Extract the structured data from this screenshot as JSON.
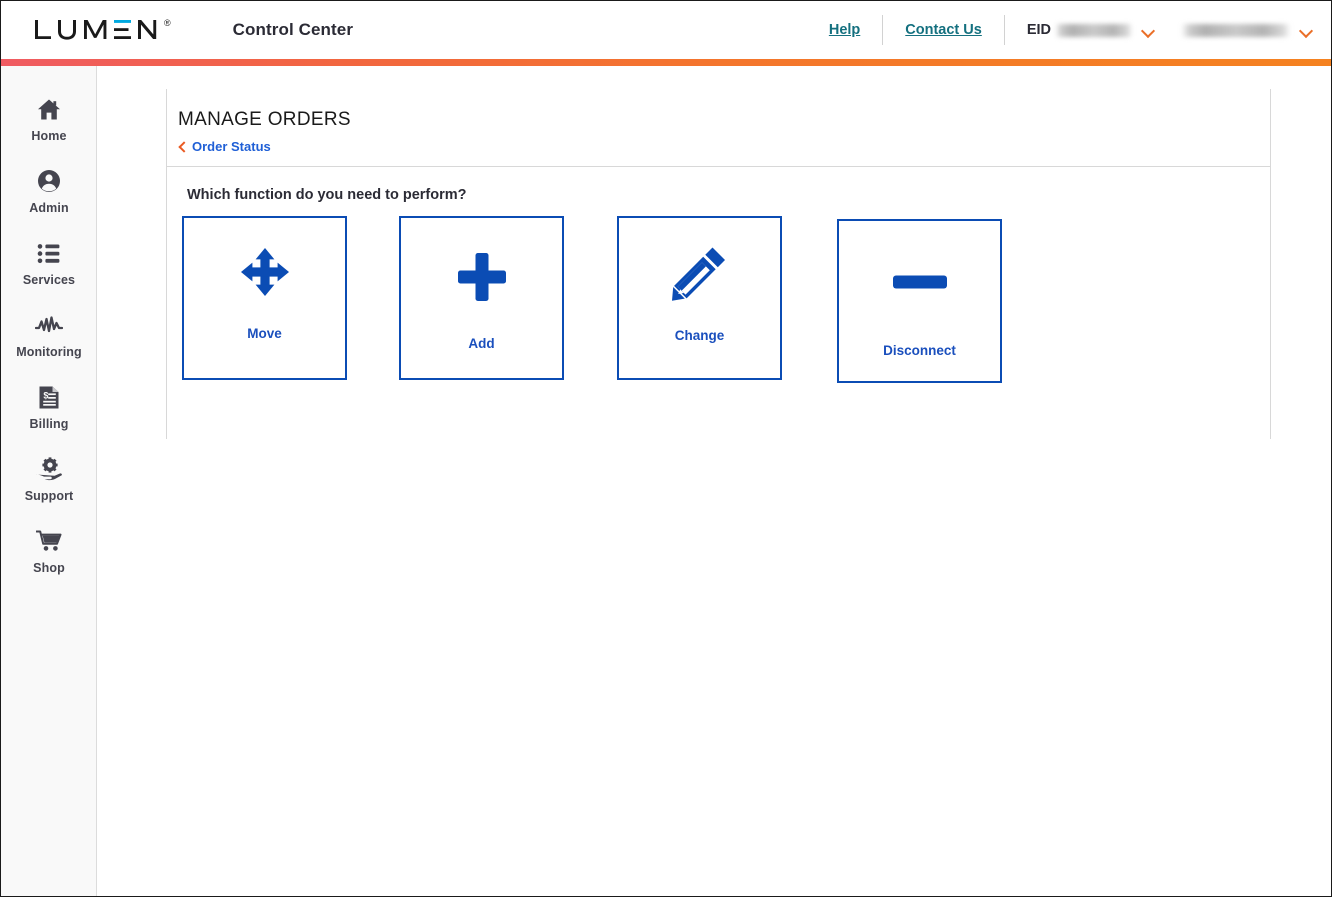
{
  "header": {
    "logo_text": "LUMEN",
    "logo_registered": "®",
    "app_title": "Control Center",
    "help_label": "Help",
    "contact_label": "Contact Us",
    "eid_label": "EID",
    "eid_value_redacted": "",
    "account_value_redacted": "",
    "link_color": "#14707f",
    "chevron_color": "#ea6f28"
  },
  "accent_bar": {
    "gradient_from": "#f05b62",
    "gradient_to": "#f58220"
  },
  "sidebar": {
    "items": [
      {
        "label": "Home",
        "icon": "home-icon"
      },
      {
        "label": "Admin",
        "icon": "user-circle-icon"
      },
      {
        "label": "Services",
        "icon": "list-icon"
      },
      {
        "label": "Monitoring",
        "icon": "waveform-icon"
      },
      {
        "label": "Billing",
        "icon": "invoice-icon"
      },
      {
        "label": "Support",
        "icon": "hand-gear-icon"
      },
      {
        "label": "Shop",
        "icon": "shopping-cart-icon"
      }
    ]
  },
  "main": {
    "page_title": "MANAGE ORDERS",
    "breadcrumb_label": "Order Status",
    "breadcrumb_color": "#1f5fd6",
    "prompt": "Which function do you need to perform?",
    "card_border_color": "#0b4cb4",
    "card_label_color": "#1a4fbd",
    "cards": [
      {
        "label": "Move",
        "icon": "arrows-move-icon"
      },
      {
        "label": "Add",
        "icon": "plus-icon"
      },
      {
        "label": "Change",
        "icon": "pencil-icon"
      },
      {
        "label": "Disconnect",
        "icon": "minus-icon"
      }
    ]
  }
}
